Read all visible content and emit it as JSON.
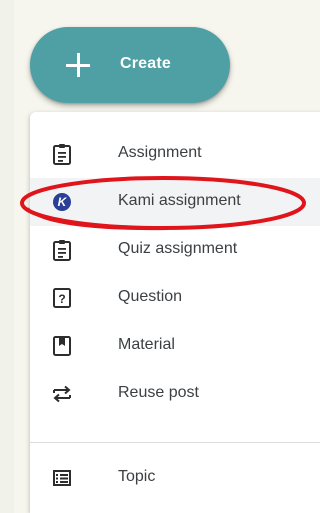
{
  "create_button": {
    "label": "Create"
  },
  "menu": {
    "items": [
      {
        "label": "Assignment",
        "icon": "assignment-icon"
      },
      {
        "label": "Kami assignment",
        "icon": "kami-icon"
      },
      {
        "label": "Quiz assignment",
        "icon": "quiz-assignment-icon"
      },
      {
        "label": "Question",
        "icon": "question-icon"
      },
      {
        "label": "Material",
        "icon": "material-icon"
      },
      {
        "label": "Reuse post",
        "icon": "reuse-post-icon"
      },
      {
        "label": "Topic",
        "icon": "topic-icon"
      }
    ]
  },
  "colors": {
    "create_button_bg": "#4ea0a4",
    "icon": "#2d2d2d",
    "kami_badge": "#2a3f96",
    "annotation": "#e0141b"
  }
}
